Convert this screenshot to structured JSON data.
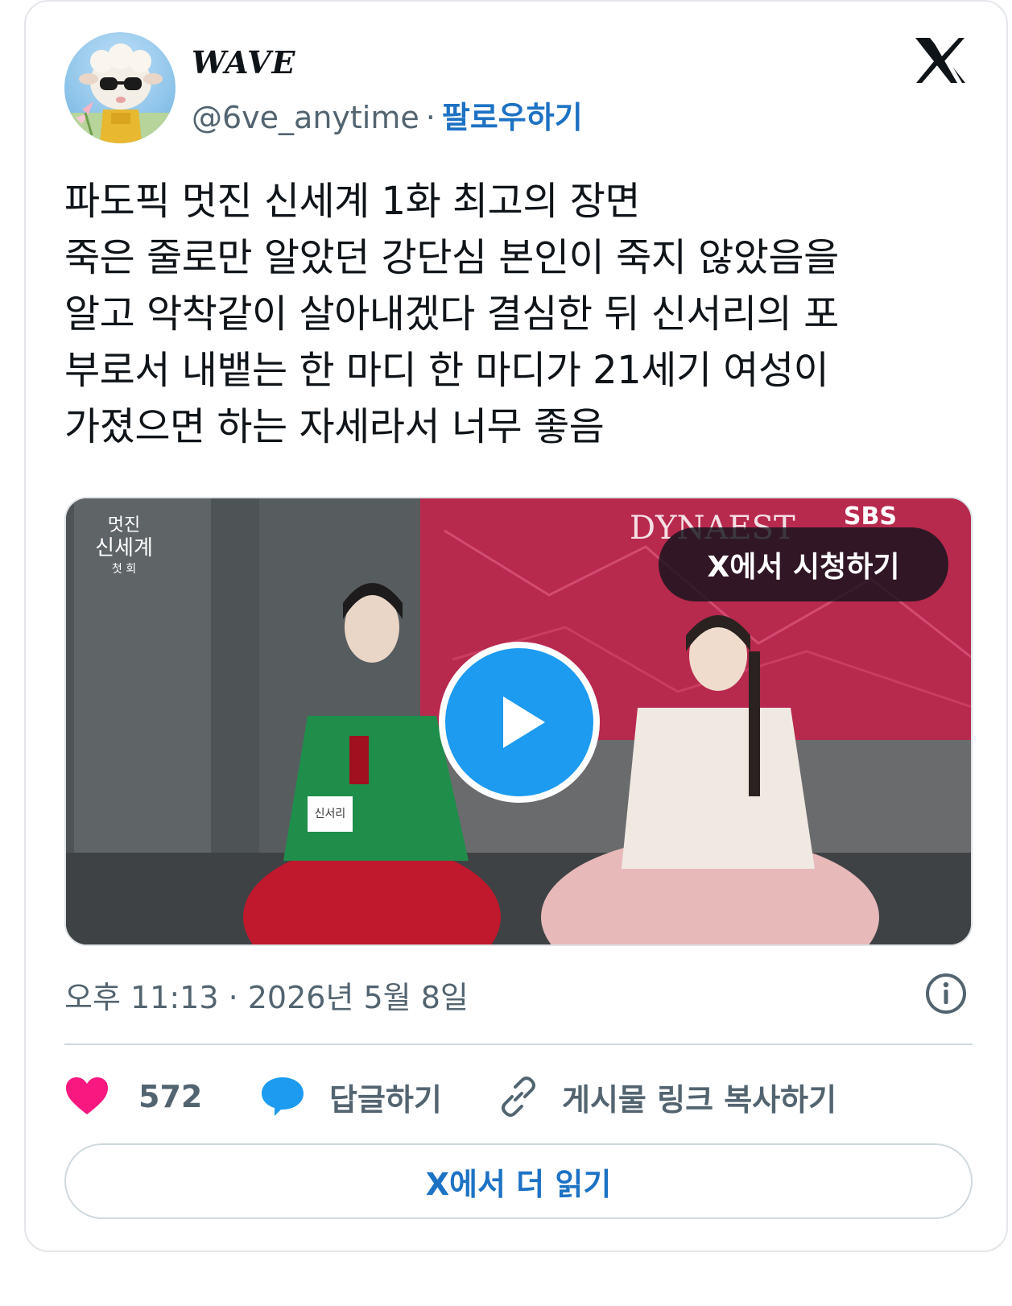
{
  "author": {
    "name": "WAVE",
    "handle": "@6ve_anytime",
    "separator": "·",
    "follow_label": "팔로우하기"
  },
  "platform_icon": "x-logo-icon",
  "tweet": {
    "text": "파도픽 멋진 신세계 1화 최고의 장면\n죽은 줄로만 알았던 강단심 본인이 죽지 않았음을\n알고 악착같이 살아내겠다 결심한 뒤 신서리의 포\n부로서 내뱉는 한 마디 한 마디가 21세기 여성이\n가졌으면 하는 자세라서 너무 좋음"
  },
  "media": {
    "watch_label": "X에서 시청하기",
    "play_icon": "play-icon",
    "overlay_logo": "멋진\n신세계",
    "overlay_sub": "첫 회",
    "broadcaster": "SBS",
    "backdrop_text": "DYNAEST",
    "name_tag": "신서리"
  },
  "meta": {
    "timestamp": "오후 11:13 · 2026년 5월 8일",
    "info_icon": "info-icon"
  },
  "actions": {
    "likes_count": "572",
    "reply_label": "답글하기",
    "copy_link_label": "게시물 링크 복사하기"
  },
  "read_more_label": "X에서 더 읽기",
  "colors": {
    "accent": "#1d72c4",
    "like": "#f91880",
    "play": "#1d9bf0",
    "muted": "#536471"
  }
}
